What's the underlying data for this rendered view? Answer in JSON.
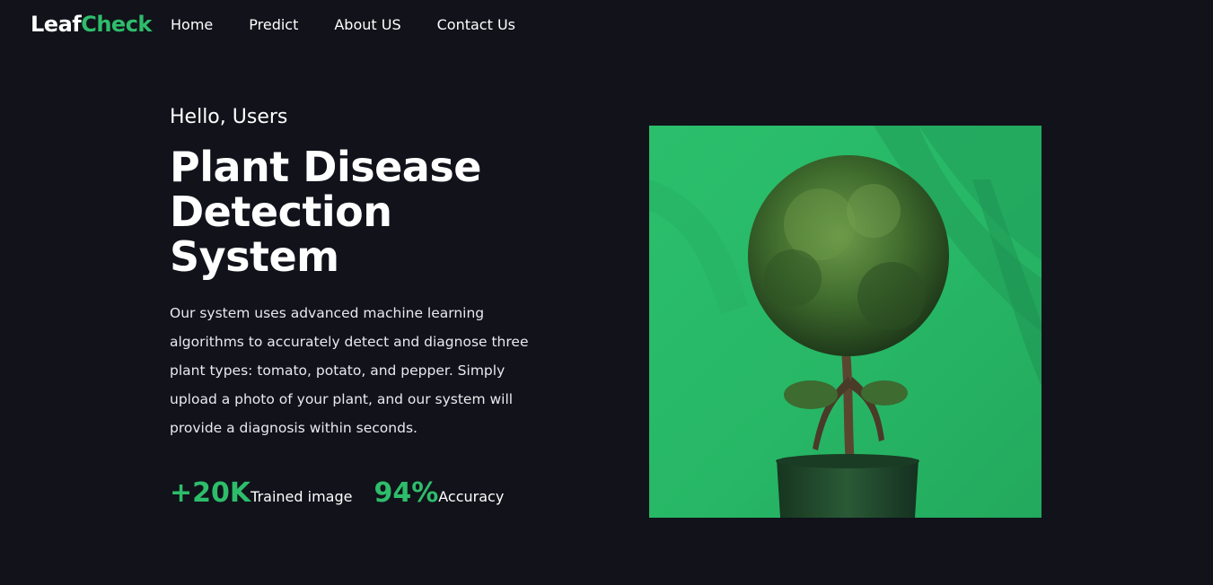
{
  "brand": {
    "part1": "Leaf",
    "part2": "Check"
  },
  "nav": {
    "items": [
      "Home",
      "Predict",
      "About US",
      "Contact Us"
    ]
  },
  "hero": {
    "greeting": "Hello, Users",
    "title_lines": [
      "Plant Disease",
      "Detection",
      "System"
    ],
    "description": "Our system uses advanced machine learning algorithms to accurately detect and diagnose three plant types: tomato, potato, and pepper. Simply upload a photo of your plant, and our system will provide a diagnosis within seconds.",
    "stats": [
      {
        "value": "+20K",
        "label": "Trained  image"
      },
      {
        "value": "94%",
        "label": "Accuracy"
      }
    ]
  },
  "colors": {
    "accent": "#2ebd6b",
    "background": "#11121a",
    "image_bg": "#2bbf6c"
  },
  "image": {
    "subject": "potted-plant-topiary"
  }
}
